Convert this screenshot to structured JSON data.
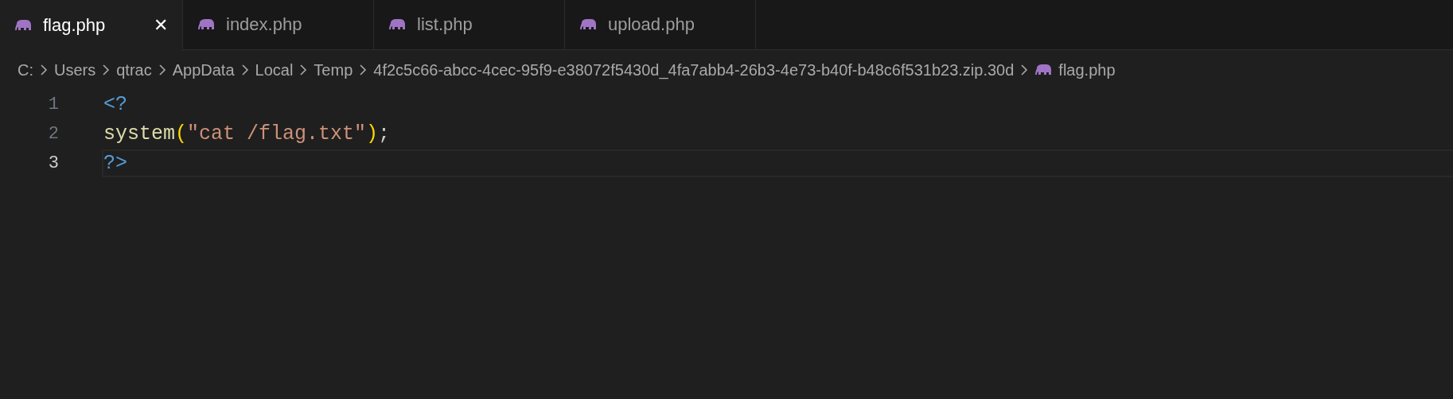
{
  "tabs": [
    {
      "label": "flag.php",
      "selected": true,
      "close": "✕"
    },
    {
      "label": "index.php",
      "selected": false
    },
    {
      "label": "list.php",
      "selected": false
    },
    {
      "label": "upload.php",
      "selected": false
    }
  ],
  "breadcrumb": [
    "C:",
    "Users",
    "qtrac",
    "AppData",
    "Local",
    "Temp",
    "4f2c5c66-abcc-4cec-95f9-e38072f5430d_4fa7abb4-26b3-4e73-b40f-b48c6f531b23.zip.30d",
    "flag.php"
  ],
  "editor": {
    "lines": [
      {
        "number": "1",
        "current": false,
        "tokens": [
          {
            "kind": "tag",
            "text": "<?"
          }
        ]
      },
      {
        "number": "2",
        "current": false,
        "tokens": [
          {
            "kind": "function",
            "text": "system"
          },
          {
            "kind": "bracket",
            "text": "("
          },
          {
            "kind": "string",
            "text": "\"cat /flag.txt\""
          },
          {
            "kind": "bracket",
            "text": ")"
          },
          {
            "kind": "plain",
            "text": ";"
          }
        ]
      },
      {
        "number": "3",
        "current": true,
        "tokens": [
          {
            "kind": "tag",
            "text": "?>"
          }
        ]
      }
    ]
  }
}
